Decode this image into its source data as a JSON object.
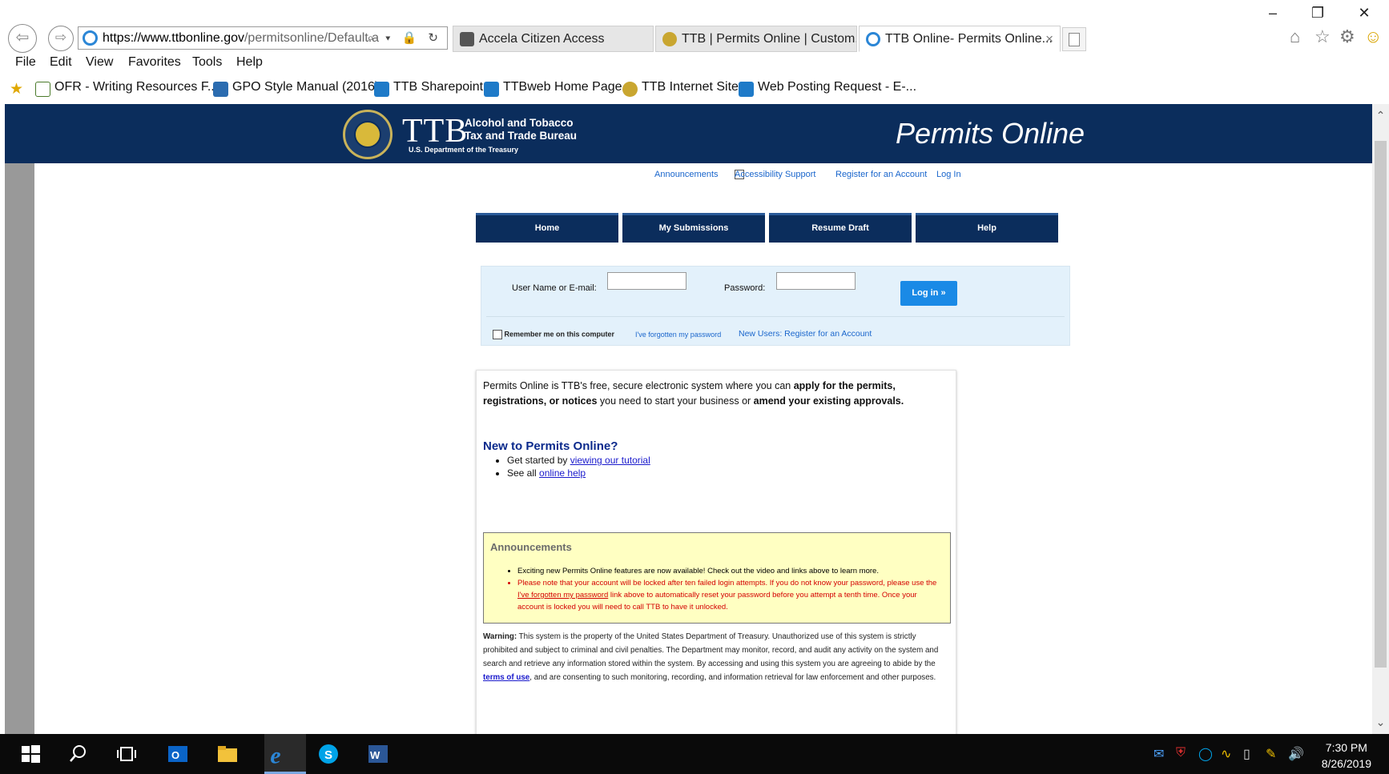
{
  "browser": {
    "url_domain": "https://www.ttbonline.gov",
    "url_rest": "/permitsonline/Default.a",
    "address_tools": "⌕ ▾ 🔒 ↻",
    "tabs": [
      {
        "label": "Accela Citizen Access",
        "icon_color": "#555555"
      },
      {
        "label": "TTB | Permits Online | Custom...",
        "icon_color": "#c9a630"
      },
      {
        "label": "TTB Online- Permits Online...",
        "icon_color": "#2b86d6",
        "close": "×"
      }
    ],
    "window_controls": [
      "–",
      "❐",
      "✕"
    ],
    "right_icons": [
      "⌂",
      "☆",
      "⚙",
      "☺"
    ],
    "menu": [
      "File",
      "Edit",
      "View",
      "Favorites",
      "Tools",
      "Help"
    ],
    "favorites": [
      {
        "label": "OFR - Writing Resources F...",
        "icon": "page-icon",
        "color": "#4a7a2a"
      },
      {
        "label": "GPO Style Manual (2016)",
        "icon": "gpo-icon",
        "color": "#2b6cb0"
      },
      {
        "label": "TTB Sharepoint",
        "icon": "sharepoint-icon",
        "color": "#1e7ac8"
      },
      {
        "label": "TTBweb Home Page",
        "icon": "sharepoint-icon",
        "color": "#1e7ac8"
      },
      {
        "label": "TTB Internet Site",
        "icon": "ttb-seal-icon",
        "color": "#c9a630"
      },
      {
        "label": "Web Posting Request - E-...",
        "icon": "sharepoint-icon",
        "color": "#1e7ac8"
      }
    ]
  },
  "site": {
    "logo_letters": "TTB",
    "agency_line1": "Alcohol and Tobacco",
    "agency_line2": "Tax and Trade Bureau",
    "agency_dept": "U.S. Department of the Treasury",
    "title": "Permits Online",
    "header_color": "#0b2d5c",
    "utility": {
      "announcements": "Announcements",
      "accessibility": "Accessibility Support",
      "register": "Register for an Account",
      "login": "Log In"
    },
    "nav": [
      "Home",
      "My Submissions",
      "Resume Draft",
      "Help"
    ]
  },
  "login": {
    "username_label": "User Name or E-mail:",
    "username_value": "",
    "password_label": "Password:",
    "password_value": "",
    "button": "Log in »",
    "remember": "Remember me on this computer",
    "forgot": "I've forgotten my password",
    "new_users": "New Users: Register for an Account"
  },
  "content": {
    "intro_1": "Permits Online is TTB's free, secure electronic system where you can ",
    "intro_2": "apply for the permits, registrations, or notices",
    "intro_3": " you need to start your business or ",
    "intro_4": "amend your existing approvals.",
    "new_heading": "New to Permits Online?",
    "item1_text": "Get started by ",
    "item1_link": "viewing our tutorial",
    "item2_text": "See all ",
    "item2_link": "online help",
    "ann_title": "Announcements",
    "ann_1": "Exciting new Permits Online features are now available! Check out the video and links above to learn more.",
    "ann_2a": "Please note that your account will be locked after ten failed login attempts. If you do not know your password, please use the ",
    "ann_2_link": "I've forgotten my password",
    "ann_2b": " link above to automatically reset your password before you attempt a tenth time. Once your account is locked you will need to call TTB to have it unlocked.",
    "warn_label": "Warning:",
    "warn_1": " This system is the property of the United States Department of Treasury.  Unauthorized use of this system is strictly prohibited and subject to criminal and civil penalties.  The Department may monitor, record, and audit any activity on the system and search and retrieve any information stored within the system.  By accessing and using this system you are agreeing to abide by the ",
    "warn_link": "terms of use",
    "warn_2": ", and are consenting to such monitoring, recording, and information retrieval for law enforcement and other purposes."
  },
  "taskbar": {
    "time": "7:30 PM",
    "date": "8/26/2019",
    "apps": [
      "start-icon",
      "search-icon",
      "task-view-icon",
      "outlook-icon",
      "file-explorer-icon",
      "internet-explorer-icon",
      "skype-icon",
      "word-icon"
    ],
    "tray": [
      "outlook-tray-icon",
      "mcafee-icon",
      "skype-tray-icon",
      "network-icon",
      "usb-icon",
      "notes-icon",
      "volume-icon"
    ]
  }
}
